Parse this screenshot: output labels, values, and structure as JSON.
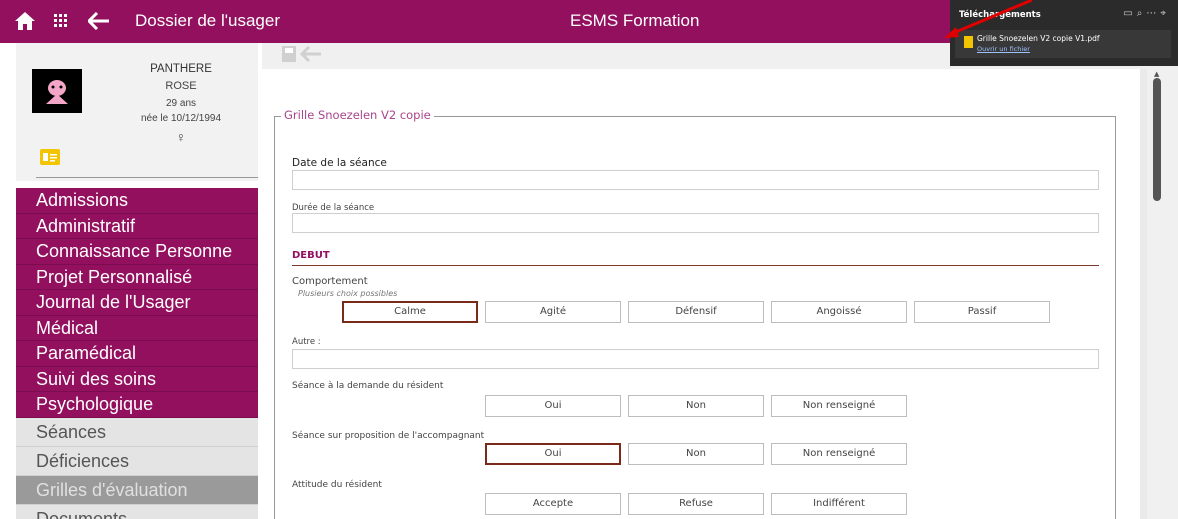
{
  "topbar": {
    "title": "Dossier de l'usager",
    "app_name": "ESMS Formation"
  },
  "patient": {
    "last_name": "PANTHERE",
    "first_name": "ROSE",
    "age": "29 ans",
    "birth": "née le 10/12/1994",
    "gender_symbol": "♀"
  },
  "menu": [
    {
      "label": "Admissions",
      "style": "primary"
    },
    {
      "label": "Administratif",
      "style": "primary"
    },
    {
      "label": "Connaissance Personne",
      "style": "primary"
    },
    {
      "label": "Projet Personnalisé",
      "style": "primary"
    },
    {
      "label": "Journal de l'Usager",
      "style": "primary"
    },
    {
      "label": "Médical",
      "style": "primary"
    },
    {
      "label": "Paramédical",
      "style": "primary"
    },
    {
      "label": "Suivi des soins",
      "style": "primary"
    },
    {
      "label": "Psychologique",
      "style": "primary"
    },
    {
      "label": "Séances",
      "style": "grey"
    },
    {
      "label": "Déficiences",
      "style": "grey"
    },
    {
      "label": "Grilles d'évaluation",
      "style": "dark"
    },
    {
      "label": "Documents",
      "style": "grey"
    }
  ],
  "form": {
    "legend": "Grille Snoezelen V2 copie",
    "date_label": "Date de la séance",
    "duree_label": "Durée de la séance",
    "section": "DEBUT",
    "comportement_label": "Comportement",
    "comportement_hint": "Plusieurs choix possibles",
    "comportement_options": [
      "Calme",
      "Agité",
      "Défensif",
      "Angoissé",
      "Passif"
    ],
    "autre_label": "Autre :",
    "demande_label": "Séance à la demande du résident",
    "demande_options": [
      "Oui",
      "Non",
      "Non renseigné"
    ],
    "proposition_label": "Séance sur proposition de l'accompagnant",
    "proposition_options": [
      "Oui",
      "Non",
      "Non renseigné"
    ],
    "attitude_label": "Attitude du résident",
    "attitude_options": [
      "Accepte",
      "Refuse",
      "Indifférent"
    ]
  },
  "downloads": {
    "title": "Téléchargements",
    "file": "Grille Snoezelen V2 copie V1.pdf",
    "open_link": "Ouvrir un fichier"
  },
  "colors": {
    "brand": "#93105f",
    "arrow": "#e00000"
  }
}
